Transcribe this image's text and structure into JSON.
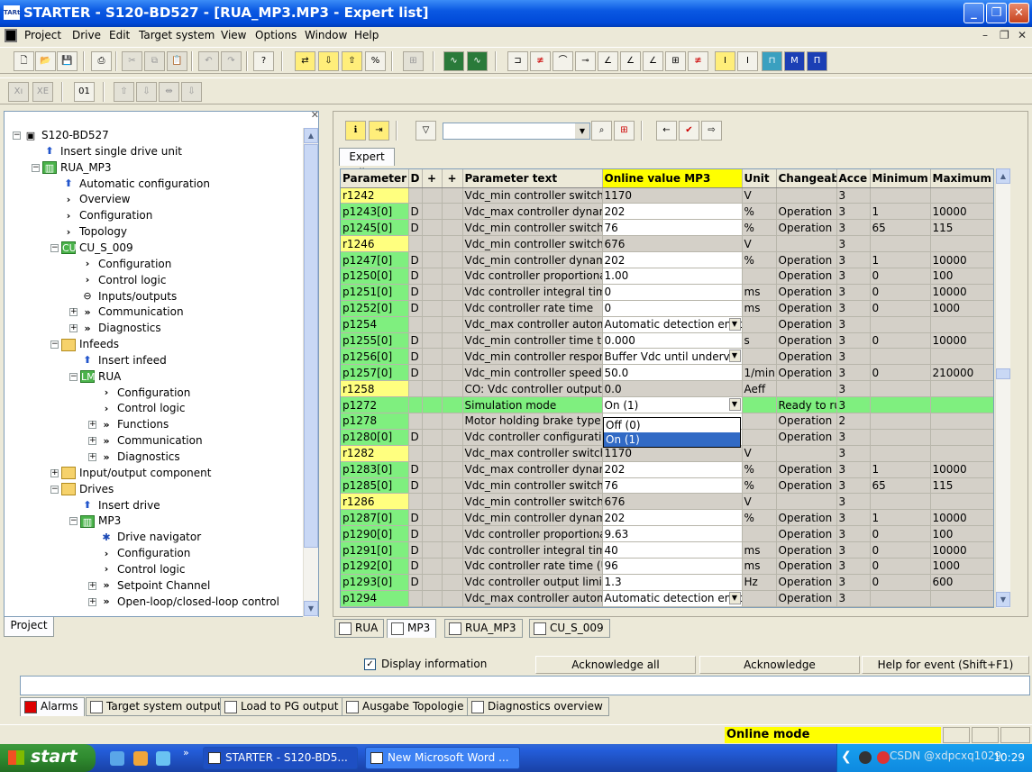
{
  "window": {
    "title": "STARTER - S120-BD527 - [RUA_MP3.MP3 - Expert list]",
    "app_icon": "TARt"
  },
  "menu": [
    "Project",
    "Drive",
    "Edit",
    "Target system",
    "View",
    "Options",
    "Window",
    "Help"
  ],
  "tree": [
    {
      "label": "S120-BD527",
      "level": 0,
      "exp": "−",
      "icon": "project"
    },
    {
      "label": "Insert single drive unit",
      "level": 1,
      "exp": "",
      "icon": "insert"
    },
    {
      "label": "RUA_MP3",
      "level": 1,
      "exp": "−",
      "icon": "drive"
    },
    {
      "label": "Automatic configuration",
      "level": 2,
      "exp": "",
      "icon": "insert"
    },
    {
      "label": "Overview",
      "level": 2,
      "exp": "",
      "icon": "chevron"
    },
    {
      "label": "Configuration",
      "level": 2,
      "exp": "",
      "icon": "chevron"
    },
    {
      "label": "Topology",
      "level": 2,
      "exp": "",
      "icon": "chevron"
    },
    {
      "label": "CU_S_009",
      "level": 2,
      "exp": "−",
      "icon": "cu"
    },
    {
      "label": "Configuration",
      "level": 3,
      "exp": "",
      "icon": "chevron"
    },
    {
      "label": "Control logic",
      "level": 3,
      "exp": "",
      "icon": "chevron"
    },
    {
      "label": "Inputs/outputs",
      "level": 3,
      "exp": "",
      "icon": "io"
    },
    {
      "label": "Communication",
      "level": 3,
      "exp": "+",
      "icon": "dchevron"
    },
    {
      "label": "Diagnostics",
      "level": 3,
      "exp": "+",
      "icon": "dchevron"
    },
    {
      "label": "Infeeds",
      "level": 2,
      "exp": "−",
      "icon": "folder"
    },
    {
      "label": "Insert infeed",
      "level": 3,
      "exp": "",
      "icon": "insert"
    },
    {
      "label": "RUA",
      "level": 3,
      "exp": "−",
      "icon": "lm"
    },
    {
      "label": "Configuration",
      "level": 4,
      "exp": "",
      "icon": "chevron"
    },
    {
      "label": "Control logic",
      "level": 4,
      "exp": "",
      "icon": "chevron"
    },
    {
      "label": "Functions",
      "level": 4,
      "exp": "+",
      "icon": "dchevron"
    },
    {
      "label": "Communication",
      "level": 4,
      "exp": "+",
      "icon": "dchevron"
    },
    {
      "label": "Diagnostics",
      "level": 4,
      "exp": "+",
      "icon": "dchevron"
    },
    {
      "label": "Input/output component",
      "level": 2,
      "exp": "+",
      "icon": "folder"
    },
    {
      "label": "Drives",
      "level": 2,
      "exp": "−",
      "icon": "folder"
    },
    {
      "label": "Insert drive",
      "level": 3,
      "exp": "",
      "icon": "insert"
    },
    {
      "label": "MP3",
      "level": 3,
      "exp": "−",
      "icon": "drive"
    },
    {
      "label": "Drive navigator",
      "level": 4,
      "exp": "",
      "icon": "gear"
    },
    {
      "label": "Configuration",
      "level": 4,
      "exp": "",
      "icon": "chevron"
    },
    {
      "label": "Control logic",
      "level": 4,
      "exp": "",
      "icon": "chevron"
    },
    {
      "label": "Setpoint Channel",
      "level": 4,
      "exp": "+",
      "icon": "dchevron"
    },
    {
      "label": "Open-loop/closed-loop control",
      "level": 4,
      "exp": "+",
      "icon": "dchevron"
    }
  ],
  "project_tab": "Project",
  "expert_tab": "Expert list",
  "columns": [
    "Parameter",
    "D",
    "+",
    "+",
    "Parameter text",
    "Online value MP3",
    "Unit",
    "Changeab",
    "Acce",
    "Minimum",
    "Maximum"
  ],
  "rows": [
    [
      "r1242",
      "",
      "",
      "",
      "Vdc_min controller switch-i",
      "1170",
      "V",
      "",
      "3",
      "",
      ""
    ],
    [
      "p1243[0]",
      "D",
      "",
      "",
      "Vdc_max controller dynami",
      "202",
      "%",
      "Operation",
      "3",
      "1",
      "10000"
    ],
    [
      "p1245[0]",
      "D",
      "",
      "",
      "Vdc_min controller switch-i",
      "76",
      "%",
      "Operation",
      "3",
      "65",
      "115"
    ],
    [
      "r1246",
      "",
      "",
      "",
      "Vdc_min controller switch-i",
      "676",
      "V",
      "",
      "3",
      "",
      ""
    ],
    [
      "p1247[0]",
      "D",
      "",
      "",
      "Vdc_min controller dynamic",
      "202",
      "%",
      "Operation",
      "3",
      "1",
      "10000"
    ],
    [
      "p1250[0]",
      "D",
      "",
      "",
      "Vdc controller proportional",
      "1.00",
      "",
      "Operation",
      "3",
      "0",
      "100"
    ],
    [
      "p1251[0]",
      "D",
      "",
      "",
      "Vdc controller integral time",
      "0",
      "ms",
      "Operation",
      "3",
      "0",
      "10000"
    ],
    [
      "p1252[0]",
      "D",
      "",
      "",
      "Vdc controller rate time",
      "0",
      "ms",
      "Operation",
      "3",
      "0",
      "1000"
    ],
    [
      "p1254",
      "",
      "",
      "",
      "Vdc_max controller automat",
      "Automatic detection enab",
      "",
      "Operation",
      "3",
      "",
      ""
    ],
    [
      "p1255[0]",
      "D",
      "",
      "",
      "Vdc_min controller time thre",
      "0.000",
      "s",
      "Operation",
      "3",
      "0",
      "10000"
    ],
    [
      "p1256[0]",
      "D",
      "",
      "",
      "Vdc_min controller respons",
      "Buffer Vdc until undervol",
      "",
      "Operation",
      "3",
      "",
      ""
    ],
    [
      "p1257[0]",
      "D",
      "",
      "",
      "Vdc_min controller speed th",
      "50.0",
      "1/min",
      "Operation",
      "3",
      "0",
      "210000"
    ],
    [
      "r1258",
      "",
      "",
      "",
      "CO: Vdc controller output",
      "0.0",
      "Aeff",
      "",
      "3",
      "",
      ""
    ],
    [
      "p1272",
      "",
      "",
      "",
      "Simulation mode",
      "On (1)",
      "",
      "Ready to ru",
      "3",
      "",
      ""
    ],
    [
      "p1278",
      "",
      "",
      "",
      "Motor holding brake type",
      "",
      "",
      "Operation",
      "2",
      "",
      ""
    ],
    [
      "p1280[0]",
      "D",
      "",
      "",
      "Vdc controller configuration",
      "",
      "",
      "Operation",
      "3",
      "",
      ""
    ],
    [
      "r1282",
      "",
      "",
      "",
      "Vdc_max controller switch-i",
      "1170",
      "V",
      "",
      "3",
      "",
      ""
    ],
    [
      "p1283[0]",
      "D",
      "",
      "",
      "Vdc_max controller dynami",
      "202",
      "%",
      "Operation",
      "3",
      "1",
      "10000"
    ],
    [
      "p1285[0]",
      "D",
      "",
      "",
      "Vdc_min controller switch-i",
      "76",
      "%",
      "Operation",
      "3",
      "65",
      "115"
    ],
    [
      "r1286",
      "",
      "",
      "",
      "Vdc_min controller switch-i",
      "676",
      "V",
      "",
      "3",
      "",
      ""
    ],
    [
      "p1287[0]",
      "D",
      "",
      "",
      "Vdc_min controller dynamic",
      "202",
      "%",
      "Operation",
      "3",
      "1",
      "10000"
    ],
    [
      "p1290[0]",
      "D",
      "",
      "",
      "Vdc controller proportional",
      "9.63",
      "",
      "Operation",
      "3",
      "0",
      "100"
    ],
    [
      "p1291[0]",
      "D",
      "",
      "",
      "Vdc controller integral time (",
      "40",
      "ms",
      "Operation",
      "3",
      "0",
      "10000"
    ],
    [
      "p1292[0]",
      "D",
      "",
      "",
      "Vdc controller rate time (U/f",
      "96",
      "ms",
      "Operation",
      "3",
      "0",
      "1000"
    ],
    [
      "p1293[0]",
      "D",
      "",
      "",
      "Vdc controller output limit (U",
      "1.3",
      "Hz",
      "Operation",
      "3",
      "0",
      "600"
    ],
    [
      "p1294",
      "",
      "",
      "",
      "Vdc_max controller automat",
      "Automatic detection enab",
      "",
      "Operation",
      "3",
      "",
      ""
    ]
  ],
  "dropdown_options": [
    "Off (0)",
    "On (1)"
  ],
  "bottom_tabs": [
    "RUA",
    "MP3",
    "RUA_MP3",
    "CU_S_009"
  ],
  "alarm": {
    "display_info": "Display information",
    "ack_all": "Acknowledge all",
    "ack": "Acknowledge",
    "help": "Help for event (Shift+F1)"
  },
  "alarm_tabs": [
    "Alarms",
    "Target system output",
    "Load to PG output",
    "Ausgabe Topologie",
    "Diagnostics overview"
  ],
  "status": {
    "mode": "Online mode"
  },
  "taskbar": {
    "start": "start",
    "tasks": [
      "STARTER - S120-BD5...",
      "New Microsoft Word ..."
    ],
    "clock": "10:29",
    "tray_overlay": "CSDN @xdpcxq1029"
  }
}
